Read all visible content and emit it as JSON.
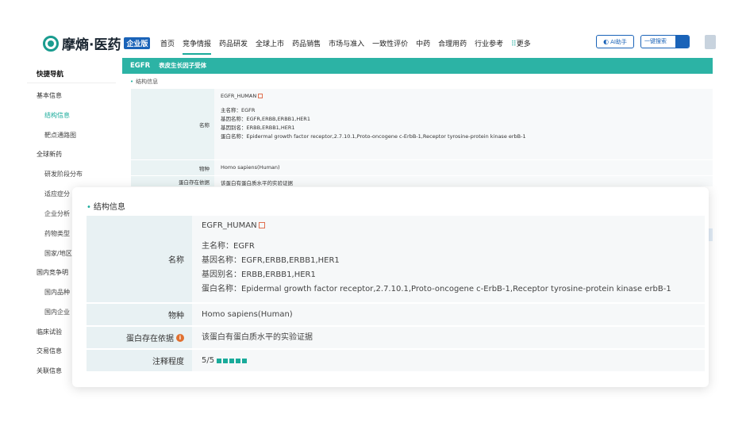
{
  "header": {
    "logo_text": "摩熵·医药",
    "logo_badge": "企业版",
    "nav": [
      "首页",
      "竞争情报",
      "药品研发",
      "全球上市",
      "药品销售",
      "市场与准入",
      "一致性评价",
      "中药",
      "合理用药",
      "行业参考"
    ],
    "nav_more": "更多",
    "nav_more_dots": "⠿",
    "ai_label": "AI助手",
    "search_label": "一键搜索"
  },
  "sidebar": {
    "title": "快捷导航",
    "items": [
      {
        "label": "基本信息"
      },
      {
        "label": "结构信息"
      },
      {
        "label": "靶点通路图"
      },
      {
        "label": "全球新药"
      },
      {
        "label": "研发阶段分布"
      },
      {
        "label": "适应症分"
      },
      {
        "label": "企业分析"
      },
      {
        "label": "药物类型"
      },
      {
        "label": "国家/地区"
      },
      {
        "label": "国内竞争明"
      },
      {
        "label": "国内品种"
      },
      {
        "label": "国内企业"
      },
      {
        "label": "临床试验"
      },
      {
        "label": "交易信息"
      },
      {
        "label": "关联信息"
      }
    ]
  },
  "main": {
    "head_title": "EGFR",
    "head_sub": "表皮生长因子受体",
    "section": "结构信息",
    "bg_rows": {
      "name_label": "名称",
      "entry": "EGFR_HUMAN",
      "primary": "主名称：EGFR",
      "gene": "基因名称：EGFR,ERBB,ERBB1,HER1",
      "alias": "基因别名：ERBB,ERBB1,HER1",
      "protein": "蛋白名称：Epidermal growth factor receptor,2.7.10.1,Proto-oncogene c-ErbB-1,Receptor tyrosine-protein kinase erbB-1",
      "species_label": "物种",
      "species": "Homo sapiens(Human)",
      "evidence_label": "蛋白存在依据",
      "evidence": "该蛋白有蛋白质水平的实验证据"
    }
  },
  "overlay": {
    "section": "结构信息",
    "name_label": "名称",
    "entry": "EGFR_HUMAN",
    "primary": "主名称：EGFR",
    "gene": "基因名称：EGFR,ERBB,ERBB1,HER1",
    "alias": "基因别名：ERBB,ERBB1,HER1",
    "protein": "蛋白名称：Epidermal growth factor receptor,2.7.10.1,Proto-oncogene c-ErbB-1,Receptor tyrosine-protein kinase erbB-1",
    "species_label": "物种",
    "species": "Homo sapiens(Human)",
    "evidence_label": "蛋白存在依据",
    "evidence": "该蛋白有蛋白质水平的实验证据",
    "annotation_label": "注释程度",
    "annotation": "5/5",
    "annotation_level": 5
  },
  "colors": {
    "accent": "#2cb3a5",
    "brand_blue": "#1a63b8"
  }
}
